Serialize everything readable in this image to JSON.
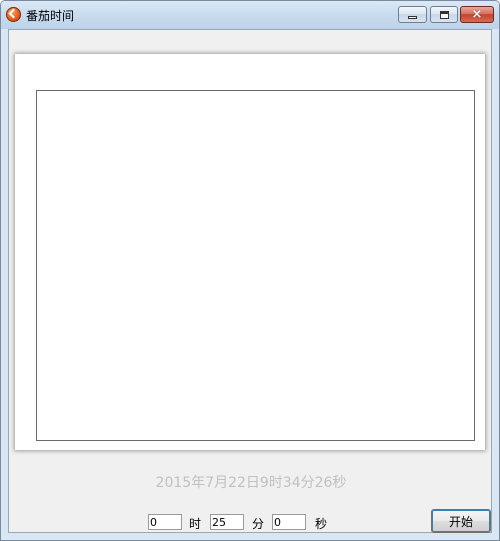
{
  "window": {
    "title": "番茄时间",
    "icon": "tomato-app-icon",
    "controls": {
      "minimize": "minimize-icon",
      "maximize": "maximize-icon",
      "close": "×"
    }
  },
  "main": {
    "datetime": "2015年7月22日9时34分26秒"
  },
  "timer": {
    "hours_value": "0",
    "hours_label": "时",
    "minutes_value": "25",
    "minutes_label": "分",
    "seconds_value": "0",
    "seconds_label": "秒",
    "start_label": "开始"
  },
  "colors": {
    "client_background": "#f0f0f0",
    "datetime_text": "#c0c0c0",
    "close_button": "#c5442d"
  }
}
